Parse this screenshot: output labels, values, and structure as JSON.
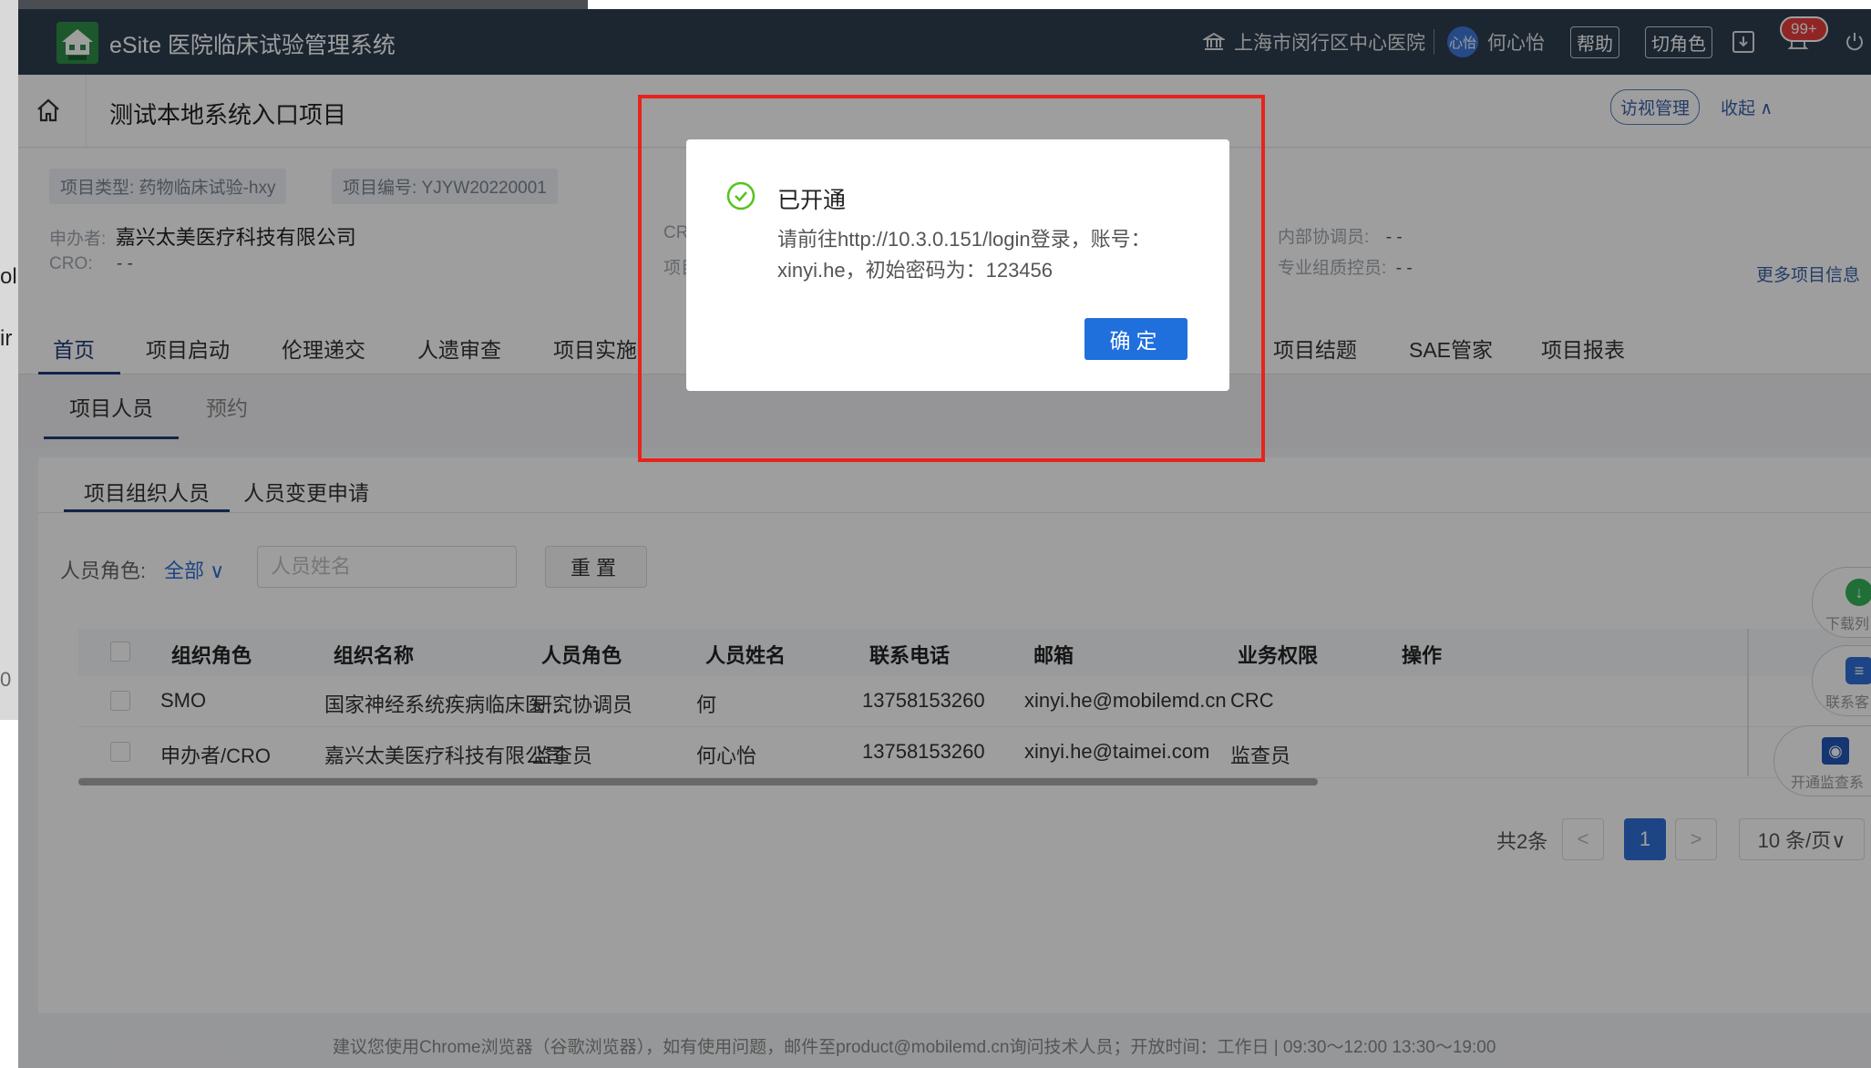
{
  "bg": {
    "text1": "ol",
    "text2": "ir",
    "text3": "0"
  },
  "app": {
    "title": "eSite 医院临床试验管理系统"
  },
  "topbar": {
    "hospital": "上海市闵行区中心医院",
    "avatar_text": "心怡",
    "user_name": "何心怡",
    "help_label": "帮助",
    "switch_role_label": "切角色",
    "badge_count": "99+"
  },
  "project": {
    "title": "测试本地系统入口项目",
    "visit_btn": "访视管理",
    "collapse_label": "收起 ∧",
    "type_tag": "项目类型:  药物临床试验-hxy",
    "code_tag": "项目编号:  YJYW20220001",
    "sponsor_label": "申办者:",
    "sponsor_value": "嘉兴太美医疗科技有限公司",
    "cro_label": "CRO:",
    "cro_value": "- -",
    "mid_label1": "CR",
    "mid_label2": "项目",
    "internal_coord_label": "内部协调员:",
    "internal_coord_value": "- -",
    "qc_label": "专业组质控员:",
    "qc_value": "- -",
    "more_info": "更多项目信息"
  },
  "nav": [
    "首页",
    "项目启动",
    "伦理递交",
    "人遗审查",
    "项目实施",
    "项目结题",
    "SAE管家",
    "项目报表"
  ],
  "subtabs": [
    "项目人员",
    "预约"
  ],
  "panel_tabs": [
    "项目组织人员",
    "人员变更申请"
  ],
  "filter": {
    "role_label": "人员角色:",
    "role_value": "全部 ∨",
    "name_placeholder": "人员姓名",
    "reset_label": "重置"
  },
  "table": {
    "headers": [
      "组织角色",
      "组织名称",
      "人员角色",
      "人员姓名",
      "联系电话",
      "邮箱",
      "业务权限",
      "操作"
    ],
    "rows": [
      [
        "SMO",
        "国家神经系统疾病临床医…",
        "研究协调员",
        "何",
        "13758153260",
        "xinyi.he@mobilemd.cn",
        "CRC"
      ],
      [
        "申办者/CRO",
        "嘉兴太美医疗科技有限公司",
        "监查员",
        "何心怡",
        "13758153260",
        "xinyi.he@taimei.com",
        "监查员"
      ]
    ]
  },
  "pagination": {
    "total": "共2条",
    "prev": "<",
    "page": "1",
    "next": ">",
    "size": "10 条/页∨"
  },
  "footer": "建议您使用Chrome浏览器（谷歌浏览器），如有使用问题，邮件至product@mobilemd.cn询问技术人员；开放时间：工作日  |  09:30～12:00 13:30～19:00",
  "floating": [
    "下载列",
    "联系客",
    "开通监查系"
  ],
  "dialog": {
    "title": "已开通",
    "message": "请前往http://10.3.0.151/login登录，账号：xinyi.he，初始密码为：123456",
    "ok_label": "确定"
  },
  "colors": {
    "topbar": "#2c3e50",
    "primary": "#2f6fd6",
    "success": "#52c41a",
    "highlight": "#e8231c"
  }
}
